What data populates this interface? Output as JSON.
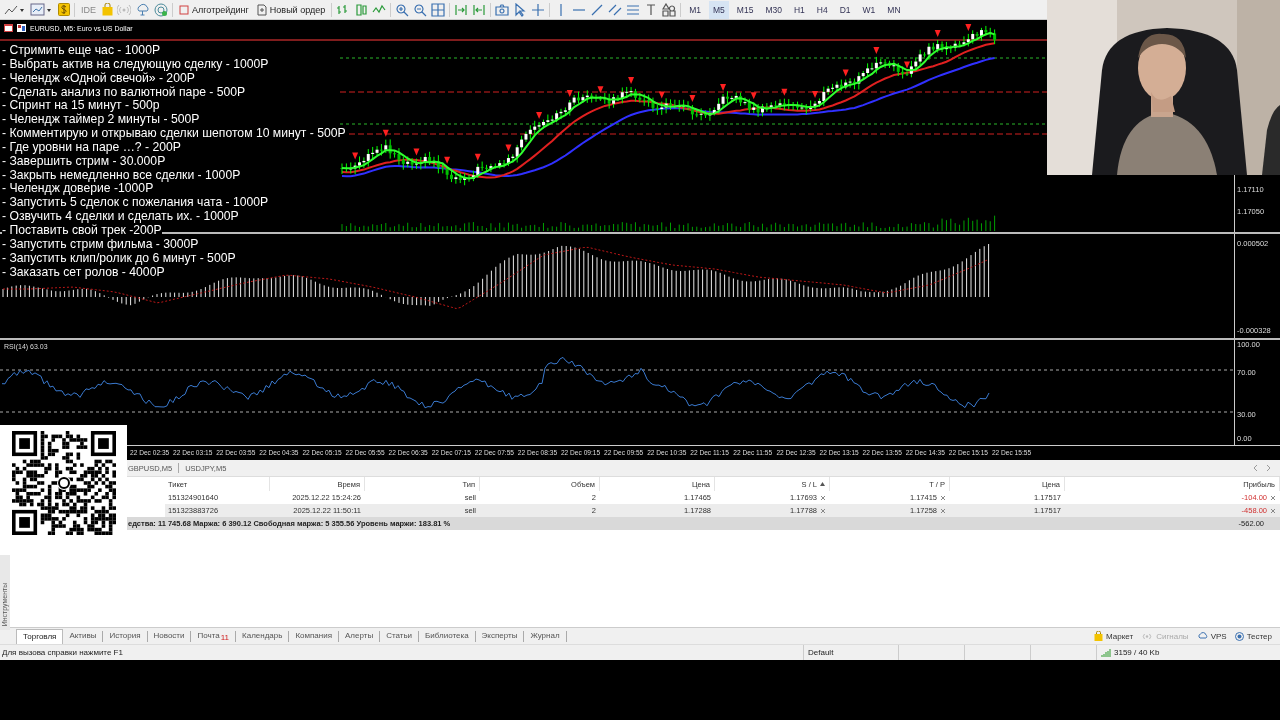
{
  "toolbar": {
    "ide": "IDE",
    "algotrading": "Алготрейдинг",
    "new_order": "Новый ордер",
    "timeframes": [
      {
        "label": "M1",
        "selected": false
      },
      {
        "label": "M5",
        "selected": true
      },
      {
        "label": "M15",
        "selected": false
      },
      {
        "label": "M30",
        "selected": false
      },
      {
        "label": "H1",
        "selected": false
      },
      {
        "label": "H4",
        "selected": false
      },
      {
        "label": "D1",
        "selected": false
      },
      {
        "label": "W1",
        "selected": false
      },
      {
        "label": "MN",
        "selected": false
      }
    ]
  },
  "chart": {
    "title": "EURUSD, M5:  Euro vs US Dollar",
    "price_ticks": [
      "1.17110",
      "1.17050"
    ],
    "macd_ticks": [
      "0.000502",
      "-0.000328"
    ],
    "rsi_label": "RSI(14) 63.03",
    "rsi_ticks": [
      "100.00",
      "70.00",
      "30.00",
      "0.00"
    ],
    "time_labels": [
      "22 Dec 02:35",
      "22 Dec 03:15",
      "22 Dec 03:55",
      "22 Dec 04:35",
      "22 Dec 05:15",
      "22 Dec 05:55",
      "22 Dec 06:35",
      "22 Dec 07:15",
      "22 Dec 07:55",
      "22 Dec 08:35",
      "22 Dec 09:15",
      "22 Dec 09:55",
      "22 Dec 10:35",
      "22 Dec 11:15",
      "22 Dec 11:55",
      "22 Dec 12:35",
      "22 Dec 13:15",
      "22 Dec 13:55",
      "22 Dec 14:35",
      "22 Dec 15:15",
      "22 Dec 15:55"
    ]
  },
  "overlay_list": [
    "- Стримить еще час - 1000Р",
    "- Выбрать актив на следующую сделку - 1000Р",
    "- Челендж «Одной свечой» - 200Р",
    "- Сделать анализ по валютной паре - 500Р",
    "- Спринт на 15 минут - 500р",
    "- Челендж таймер 2 минуты - 500Р",
    "- Комментирую и открываю сделки шепотом 10 минут - 500Р",
    "- Где уровни на паре …?  - 200Р",
    "- Завершить стрим - 30.000Р",
    "- Закрыть немедленно все сделки - 1000Р",
    "- Челендж доверие -1000Р",
    "- Запустить 5 сделок с пожелания чата - 1000Р",
    "- Озвучить 4 сделки и сделать их. - 1000Р",
    "- Поставить свой трек -200Р",
    "- Запустить стрим фильма - 3000Р",
    "- Запустить клип/ролик до 6 минут - 500Р",
    "- Заказать сет ролов - 4000Р"
  ],
  "symbol_tabs": [
    "GBPUSD,M5",
    "USDJPY,M5"
  ],
  "table": {
    "columns": [
      "Тикет",
      "Время",
      "Тип",
      "Объем",
      "Цена",
      "S / L",
      "T / P",
      "Цена",
      "Прибыль"
    ],
    "rows": [
      {
        "cells": [
          "151324901640",
          "2025.12.22 15:24:26",
          "sell",
          "2",
          "1.17465",
          "1.17693",
          "1.17415",
          "1.17517",
          "-104.00"
        ]
      },
      {
        "cells": [
          "151323883726",
          "2025.12.22 11:50:11",
          "sell",
          "2",
          "1.17288",
          "1.17788",
          "1.17258",
          "1.17517",
          "-458.00"
        ]
      }
    ],
    "summary": "едства: 11 745.68  Маржа: 6 390.12  Свободная маржа: 5 355.56  Уровень маржи: 183.81 %",
    "total": "-562.00"
  },
  "side_label": "Инструменты",
  "bottom_tabs": [
    {
      "label": "Торговля",
      "selected": true
    },
    {
      "label": "Активы",
      "selected": false
    },
    {
      "label": "История",
      "selected": false
    },
    {
      "label": "Новости",
      "selected": false
    },
    {
      "label": "Почта",
      "selected": false,
      "badge": "11"
    },
    {
      "label": "Календарь",
      "selected": false
    },
    {
      "label": "Компания",
      "selected": false
    },
    {
      "label": "Алерты",
      "selected": false
    },
    {
      "label": "Статьи",
      "selected": false
    },
    {
      "label": "Библиотека",
      "selected": false
    },
    {
      "label": "Эксперты",
      "selected": false
    },
    {
      "label": "Журнал",
      "selected": false
    }
  ],
  "right_buttons": [
    {
      "kind": "market",
      "label": "Маркет",
      "disabled": false
    },
    {
      "kind": "signals",
      "label": "Сигналы",
      "disabled": true
    },
    {
      "kind": "vps",
      "label": "VPS",
      "disabled": false
    },
    {
      "kind": "tester",
      "label": "Тестер",
      "disabled": false
    }
  ],
  "status_bar": {
    "help": "Для вызова справки нажмите F1",
    "profile": "Default",
    "traffic": "3159 / 40 Kb"
  }
}
